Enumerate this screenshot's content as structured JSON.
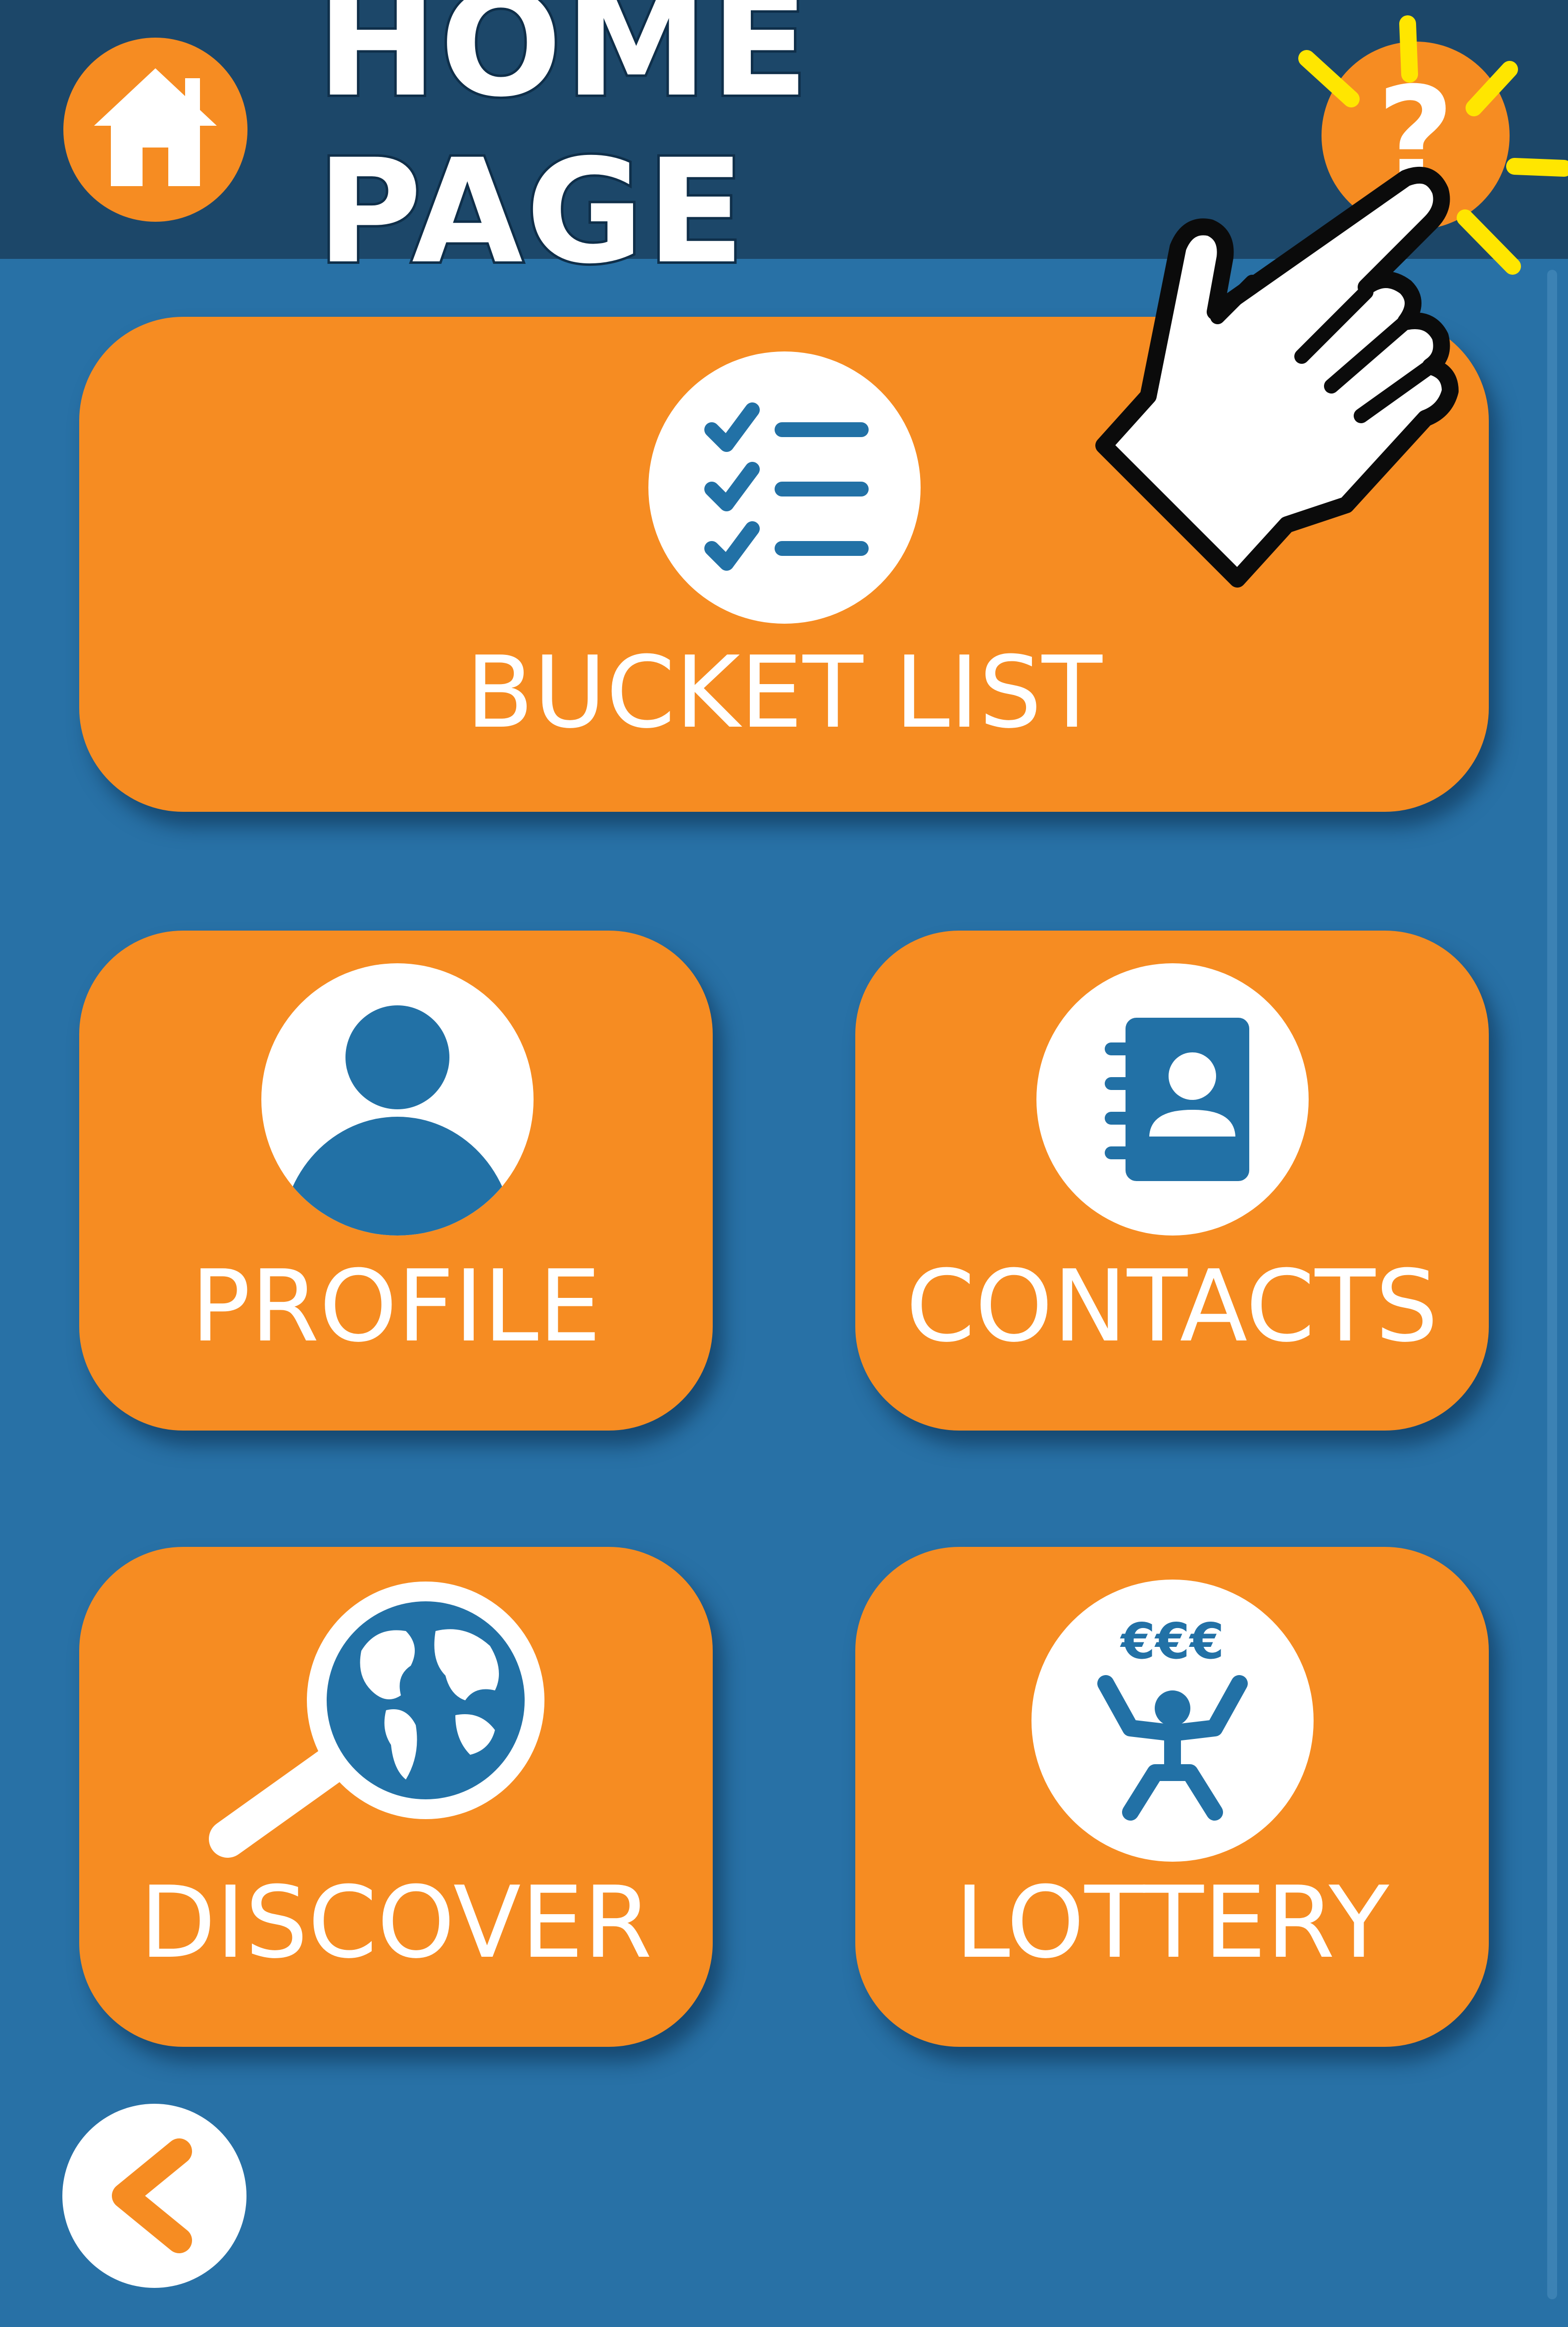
{
  "header": {
    "title": "HOME PAGE",
    "help_label": "?"
  },
  "tiles": [
    {
      "id": "bucket-list",
      "label": "BUCKET LIST",
      "icon": "checklist-icon"
    },
    {
      "id": "profile",
      "label": "PROFILE",
      "icon": "user-icon"
    },
    {
      "id": "contacts",
      "label": "CONTACTS",
      "icon": "address-book-icon"
    },
    {
      "id": "discover",
      "label": "DISCOVER",
      "icon": "globe-magnifier-icon"
    },
    {
      "id": "lottery",
      "label": "LOTTERY",
      "icon": "lottery-winner-icon"
    }
  ],
  "lottery_icon_text": "€€€",
  "colors": {
    "background": "#2871a6",
    "header": "#1c4769",
    "tile": "#f68c22",
    "icon_blue": "#2271a6",
    "sparkle": "#ffe600"
  }
}
